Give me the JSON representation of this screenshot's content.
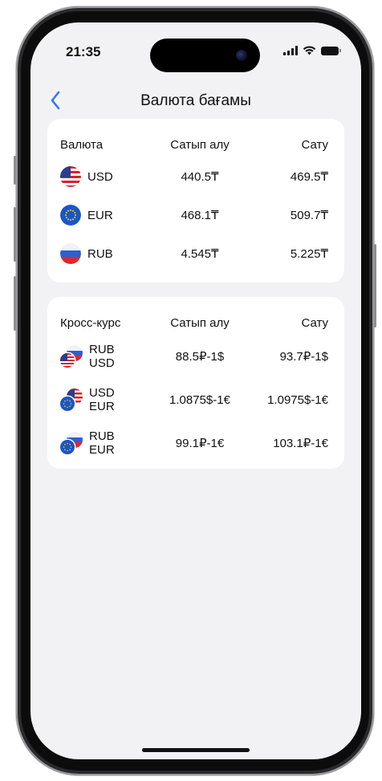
{
  "status_bar": {
    "time": "21:35"
  },
  "nav": {
    "title": "Валюта бағамы"
  },
  "rates": {
    "headers": [
      "Валюта",
      "Сатып алу",
      "Сату"
    ],
    "rows": [
      {
        "code": "USD",
        "flag": "us-flag-icon",
        "buy": "440.5₸",
        "sell": "469.5₸"
      },
      {
        "code": "EUR",
        "flag": "eu-flag-icon",
        "buy": "468.1₸",
        "sell": "509.7₸"
      },
      {
        "code": "RUB",
        "flag": "ru-flag-icon",
        "buy": "4.545₸",
        "sell": "5.225₸"
      }
    ]
  },
  "cross": {
    "headers": [
      "Кросс-курс",
      "Сатып алу",
      "Сату"
    ],
    "rows": [
      {
        "top": "RUB",
        "bottom": "USD",
        "buy": "88.5₽-1$",
        "sell": "93.7₽-1$"
      },
      {
        "top": "USD",
        "bottom": "EUR",
        "buy": "1.0875$-1€",
        "sell": "1.0975$-1€"
      },
      {
        "top": "RUB",
        "bottom": "EUR",
        "buy": "99.1₽-1€",
        "sell": "103.1₽-1€"
      }
    ]
  },
  "colors": {
    "accent": "#3478F6",
    "background": "#F2F2F4",
    "card": "#FFFFFF",
    "text": "#111111"
  }
}
